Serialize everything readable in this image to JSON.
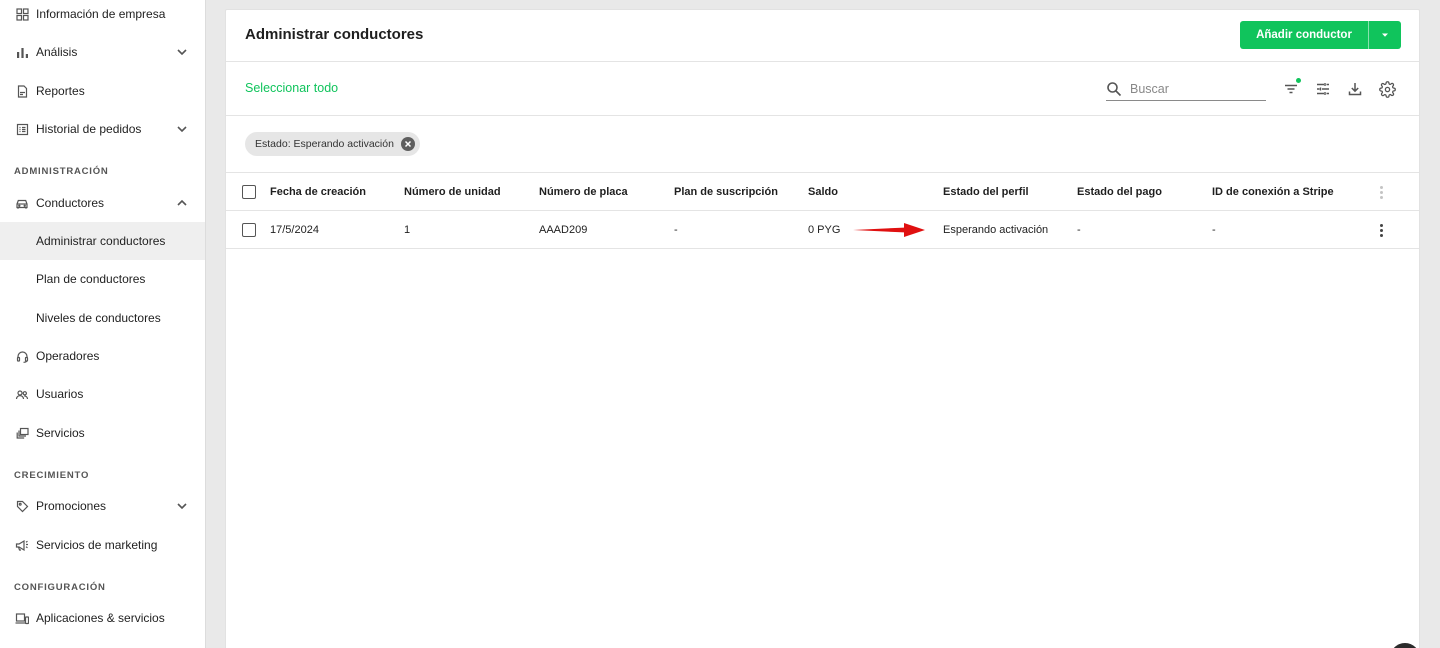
{
  "sidebar": {
    "items": {
      "empresa": "Información de empresa",
      "analisis": "Análisis",
      "reportes": "Reportes",
      "historial": "Historial de pedidos",
      "conductores": "Conductores",
      "administrar": "Administrar conductores",
      "plan": "Plan de conductores",
      "niveles": "Niveles de conductores",
      "operadores": "Operadores",
      "usuarios": "Usuarios",
      "servicios": "Servicios",
      "promociones": "Promociones",
      "marketing": "Servicios de marketing",
      "aplicaciones": "Aplicaciones & servicios"
    },
    "sections": {
      "administracion": "ADMINISTRACIÓN",
      "crecimiento": "CRECIMIENTO",
      "configuracion": "CONFIGURACIÓN"
    },
    "active_item": "Administrar conductores"
  },
  "header": {
    "title": "Administrar conductores",
    "add_button": "Añadir conductor"
  },
  "toolbar": {
    "select_all": "Seleccionar todo",
    "search_placeholder": "Buscar"
  },
  "filters": {
    "chip": "Estado: Esperando activación"
  },
  "table": {
    "columns": {
      "fecha": "Fecha de creación",
      "unidad": "Número de unidad",
      "placa": "Número de placa",
      "plan": "Plan de suscripción",
      "saldo": "Saldo",
      "perfil": "Estado del perfil",
      "pago": "Estado del pago",
      "stripe": "ID de conexión a Stripe"
    },
    "rows": [
      {
        "fecha": "17/5/2024",
        "unidad": "1",
        "placa": "AAAD209",
        "plan": "-",
        "saldo": "0 PYG",
        "perfil": "Esperando activación",
        "pago": "-",
        "stripe": "-"
      }
    ]
  },
  "colors": {
    "accent": "#10c45c",
    "arrow": "#e01010"
  }
}
